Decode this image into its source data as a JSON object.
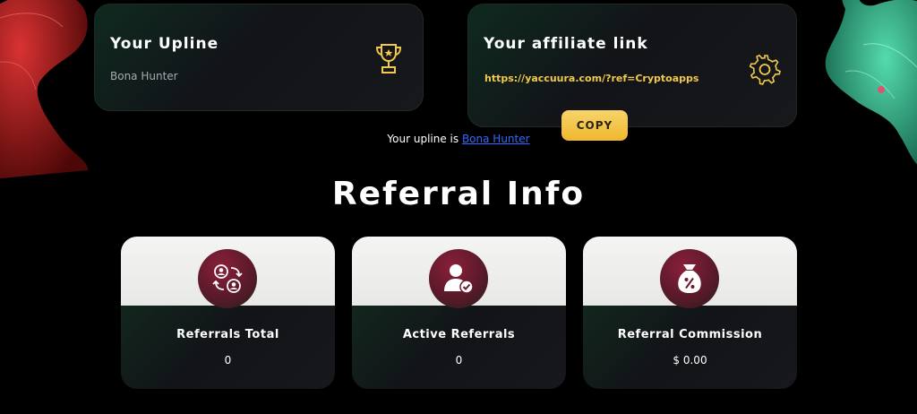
{
  "upline_card": {
    "title": "Your Upline",
    "name": "Bona Hunter"
  },
  "affiliate_card": {
    "title": "Your affiliate link",
    "link": "https://yaccuura.com/?ref=Cryptoapps",
    "copy_label": "COPY"
  },
  "upline_line": {
    "prefix": "Your upline is ",
    "name": "Bona Hunter"
  },
  "section_title": "Referral Info",
  "stats": [
    {
      "label": "Referrals Total",
      "value": "0",
      "icon": "referral-swap-icon"
    },
    {
      "label": "Active Referrals",
      "value": "0",
      "icon": "user-check-icon"
    },
    {
      "label": "Referral Commission",
      "value": "$ 0.00",
      "icon": "money-bag-percent-icon"
    }
  ],
  "colors": {
    "accent": "#f2c94c",
    "link": "#2f6bff",
    "icon_bg": "#7a1d35"
  }
}
